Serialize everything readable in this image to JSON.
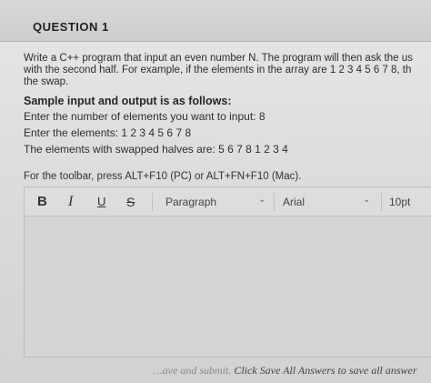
{
  "question": {
    "title": "QUESTION 1",
    "paragraph_lines": [
      "Write a C++ program that input an even number N. The program will then ask the us",
      "with the second half. For example, if the elements in the array are 1 2 3 4 5 6 7 8, th",
      "the swap."
    ],
    "sample_heading": "Sample input and output is as follows:",
    "sample_lines": [
      "Enter the number of elements you want to input: 8",
      "Enter the elements: 1 2 3 4 5 6 7 8",
      "The elements with swapped halves are: 5 6 7 8 1 2 3 4"
    ]
  },
  "editor": {
    "toolbar_hint": "For the toolbar, press ALT+F10 (PC) or ALT+FN+F10 (Mac).",
    "buttons": {
      "bold": "B",
      "italic": "I",
      "underline": "U",
      "strike": "S"
    },
    "paragraph_select": "Paragraph",
    "font_select": "Arial",
    "size_select": "10pt"
  },
  "footer": {
    "faded": "…ave and submit. ",
    "text": "Click Save All Answers to save all answer"
  }
}
